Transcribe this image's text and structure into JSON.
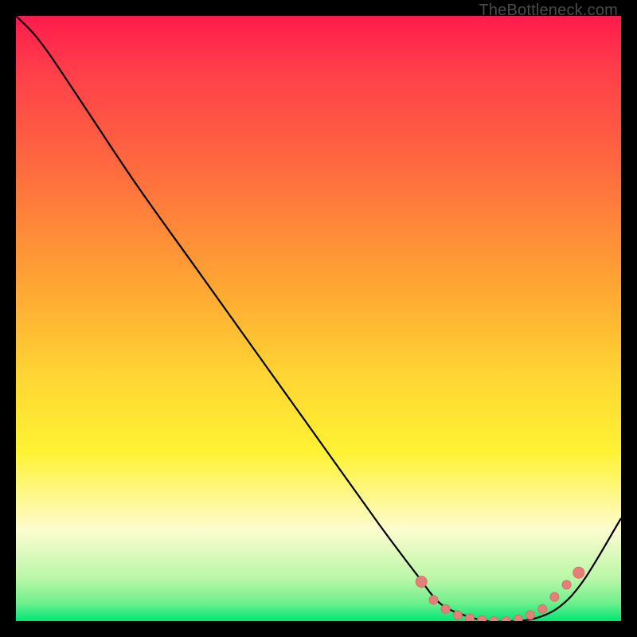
{
  "attribution": "TheBottleneck.com",
  "colors": {
    "background": "#000000",
    "curve_stroke": "#000000",
    "marker_fill": "#e58079",
    "marker_stroke": "#d86e68"
  },
  "chart_data": {
    "type": "line",
    "title": "",
    "xlabel": "",
    "ylabel": "",
    "xlim": [
      0,
      100
    ],
    "ylim": [
      0,
      100
    ],
    "series": [
      {
        "name": "bottleneck-curve",
        "x": [
          0,
          3,
          6,
          12,
          20,
          30,
          40,
          50,
          60,
          66,
          70,
          74,
          78,
          82,
          86,
          90,
          94,
          100
        ],
        "y": [
          100,
          97,
          93,
          84,
          72,
          58,
          44,
          30,
          16,
          8,
          3,
          1,
          0,
          0,
          0.5,
          2.5,
          7,
          17
        ]
      }
    ],
    "markers": {
      "name": "highlight-dots",
      "x": [
        67,
        69,
        71,
        73,
        75,
        77,
        79,
        81,
        83,
        85,
        87,
        89,
        91,
        93
      ],
      "y": [
        6.5,
        3.5,
        2,
        1,
        0.5,
        0.2,
        0,
        0,
        0.3,
        1,
        2,
        4,
        6,
        8
      ]
    }
  }
}
